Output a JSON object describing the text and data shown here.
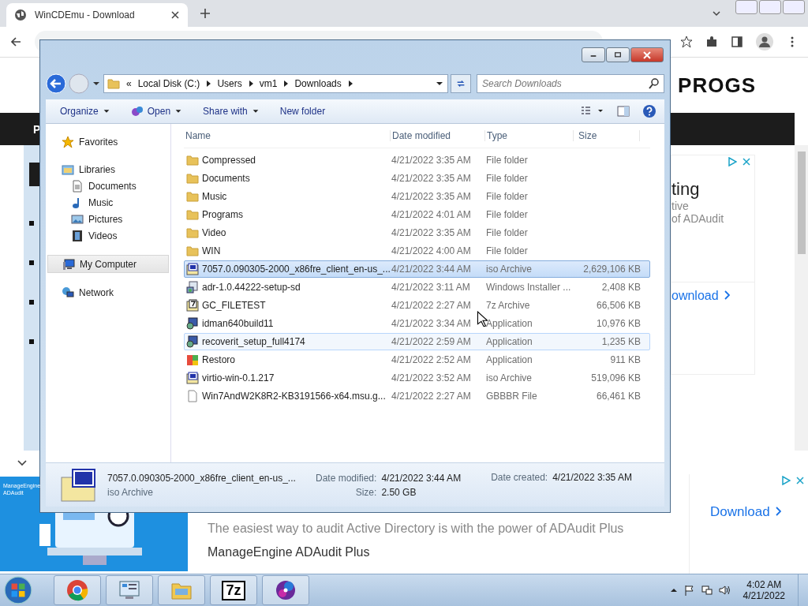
{
  "browser": {
    "tab_title": "WinCDEmu - Download"
  },
  "page": {
    "logo": "PROGS",
    "nav_letter": "P",
    "ad_top": {
      "heading": "ting",
      "line_1": "tive",
      "line_2": "of ADAudit",
      "link": "ownload"
    },
    "ad_bottom": {
      "brand": "ManageEngine ADAudit",
      "text": "The easiest way to audit Active Directory is with the power of ADAudit Plus",
      "advertiser": "ManageEngine ADAudit Plus",
      "link": "Download"
    }
  },
  "explorer": {
    "breadcrumb_overflow": "«",
    "breadcrumb": [
      "Local Disk (C:)",
      "Users",
      "vm1",
      "Downloads"
    ],
    "search": {
      "placeholder": "Search Downloads"
    },
    "toolbar": [
      {
        "label": "Organize",
        "kind": "menu"
      },
      {
        "label": "Open",
        "kind": "open"
      },
      {
        "label": "Share with",
        "kind": "menu"
      },
      {
        "label": "New folder",
        "kind": "plain"
      }
    ],
    "nav": [
      {
        "label": "Favorites",
        "kind": "star",
        "selected": false
      },
      {
        "label": "Libraries",
        "kind": "library",
        "selected": false,
        "children": [
          {
            "label": "Documents",
            "kind": "document",
            "selected": false
          },
          {
            "label": "Music",
            "kind": "music",
            "selected": false
          },
          {
            "label": "Pictures",
            "kind": "pictures",
            "selected": false
          },
          {
            "label": "Videos",
            "kind": "videos",
            "selected": false
          }
        ]
      },
      {
        "label": "My Computer",
        "kind": "computer",
        "selected": true
      },
      {
        "label": "Network",
        "kind": "network",
        "selected": false
      }
    ],
    "columns": [
      "Name",
      "Date modified",
      "Type",
      "Size"
    ],
    "rows": [
      {
        "name": "Compressed",
        "date": "4/21/2022 3:35 AM",
        "type": "File folder",
        "size": "",
        "kind": "folder",
        "selected": false,
        "hot": false
      },
      {
        "name": "Documents",
        "date": "4/21/2022 3:35 AM",
        "type": "File folder",
        "size": "",
        "kind": "folder",
        "selected": false,
        "hot": false
      },
      {
        "name": "Music",
        "date": "4/21/2022 3:35 AM",
        "type": "File folder",
        "size": "",
        "kind": "folder",
        "selected": false,
        "hot": false
      },
      {
        "name": "Programs",
        "date": "4/21/2022 4:01 AM",
        "type": "File folder",
        "size": "",
        "kind": "folder",
        "selected": false,
        "hot": false
      },
      {
        "name": "Video",
        "date": "4/21/2022 3:35 AM",
        "type": "File folder",
        "size": "",
        "kind": "folder",
        "selected": false,
        "hot": false
      },
      {
        "name": "WIN",
        "date": "4/21/2022 4:00 AM",
        "type": "File folder",
        "size": "",
        "kind": "folder",
        "selected": false,
        "hot": false
      },
      {
        "name": "7057.0.090305-2000_x86fre_client_en-us_...",
        "date": "4/21/2022 3:44 AM",
        "type": "iso Archive",
        "size": "2,629,106 KB",
        "kind": "iso",
        "selected": true,
        "hot": false
      },
      {
        "name": "adr-1.0.44222-setup-sd",
        "date": "4/21/2022 3:11 AM",
        "type": "Windows Installer ...",
        "size": "2,408 KB",
        "kind": "installer",
        "selected": false,
        "hot": false
      },
      {
        "name": "GC_FILETEST",
        "date": "4/21/2022 2:27 AM",
        "type": "7z Archive",
        "size": "66,506 KB",
        "kind": "archive",
        "selected": false,
        "hot": false
      },
      {
        "name": "idman640build11",
        "date": "4/21/2022 3:34 AM",
        "type": "Application",
        "size": "10,976 KB",
        "kind": "app",
        "selected": false,
        "hot": false
      },
      {
        "name": "recoverit_setup_full4174",
        "date": "4/21/2022 2:59 AM",
        "type": "Application",
        "size": "1,235 KB",
        "kind": "app",
        "selected": false,
        "hot": true
      },
      {
        "name": "Restoro",
        "date": "4/21/2022 2:52 AM",
        "type": "Application",
        "size": "911 KB",
        "kind": "colorapp",
        "selected": false,
        "hot": false
      },
      {
        "name": "virtio-win-0.1.217",
        "date": "4/21/2022 3:52 AM",
        "type": "iso Archive",
        "size": "519,096 KB",
        "kind": "iso",
        "selected": false,
        "hot": false
      },
      {
        "name": "Win7AndW2K8R2-KB3191566-x64.msu.g...",
        "date": "4/21/2022 2:27 AM",
        "type": "GBBBR File",
        "size": "66,461 KB",
        "kind": "file",
        "selected": false,
        "hot": false
      }
    ],
    "details": {
      "name": "7057.0.090305-2000_x86fre_client_en-us_...",
      "type": "iso Archive",
      "modified_label": "Date modified:",
      "modified": "4/21/2022 3:44 AM",
      "created_label": "Date created:",
      "created": "4/21/2022 3:35 AM",
      "size_label": "Size:",
      "size": "2.50 GB"
    }
  },
  "taskbar": {
    "apps": [
      {
        "kind": "chrome"
      },
      {
        "kind": "control"
      },
      {
        "kind": "explorer"
      },
      {
        "kind": "sevenzip",
        "label": "7z"
      },
      {
        "kind": "disc"
      }
    ],
    "time": "4:02 AM",
    "date": "4/21/2022"
  }
}
